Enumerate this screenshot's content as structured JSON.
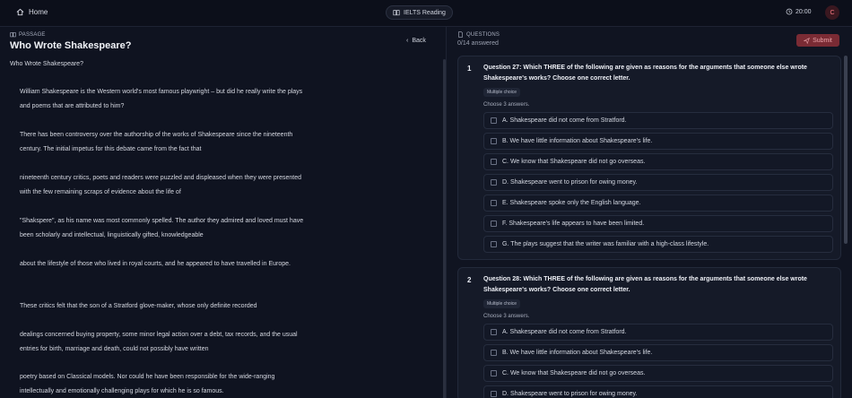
{
  "topbar": {
    "home_label": "Home",
    "mode_label": "IELTS Reading",
    "timer": "20:00",
    "avatar_letter": "C"
  },
  "passage": {
    "caption": "PASSAGE",
    "title": "Who Wrote Shakespeare?",
    "back_label": "Back",
    "subtitle": "Who Wrote Shakespeare?",
    "paragraphs": [
      "William Shakespeare is the Western world's most famous playwright – but did he really write the plays and poems that are attributed to him?",
      "There has been controversy over the authorship of the works of Shakespeare since the nineteenth century. The initial impetus for this debate came from the fact that",
      "nineteenth century critics, poets and readers were puzzled and displeased when they were presented with the few remaining scraps of evidence about the life of",
      "\"Shakspere\", as his name was most commonly spelled. The author they admired and loved must have been scholarly and intellectual, linguistically gifted, knowledgeable",
      "about the lifestyle of those who lived in royal courts, and he appeared to have travelled in Europe.",
      "These critics felt that the son of a Stratford glove-maker, whose only definite recorded",
      "dealings concerned buying property, some minor legal action over a debt, tax records, and the usual entries for birth, marriage and death, could not possibly have written",
      "poetry based on Classical models. Nor could he have been responsible for the wide-ranging intellectually and emotionally challenging plays for which he is so famous."
    ]
  },
  "questions": {
    "caption": "QUESTIONS",
    "answered": "0/14 answered",
    "submit_label": "Submit",
    "items": [
      {
        "number": "1",
        "text": "Question 27: Which THREE of the following are given as reasons for the arguments that someone else wrote Shakespeare's works? Choose one correct letter.",
        "type": "Multiple choice",
        "choose": "Choose 3 answers.",
        "options": [
          "A. Shakespeare did not come from Stratford.",
          "B. We have little information about Shakespeare's life.",
          "C. We know that Shakespeare did not go overseas.",
          "D. Shakespeare went to prison for owing money.",
          "E. Shakespeare spoke only the English language.",
          "F. Shakespeare's life appears to have been limited.",
          "G. The plays suggest that the writer was familiar with a high-class lifestyle."
        ]
      },
      {
        "number": "2",
        "text": "Question 28: Which THREE of the following are given as reasons for the arguments that someone else wrote Shakespeare's works? Choose one correct letter.",
        "type": "Multiple choice",
        "choose": "Choose 3 answers.",
        "options": [
          "A. Shakespeare did not come from Stratford.",
          "B. We have little information about Shakespeare's life.",
          "C. We know that Shakespeare did not go overseas.",
          "D. Shakespeare went to prison for owing money."
        ]
      }
    ]
  },
  "colors": {
    "background": "#0f1320",
    "submit": "#7a2b34",
    "accent_text": "#e9ecf3"
  }
}
